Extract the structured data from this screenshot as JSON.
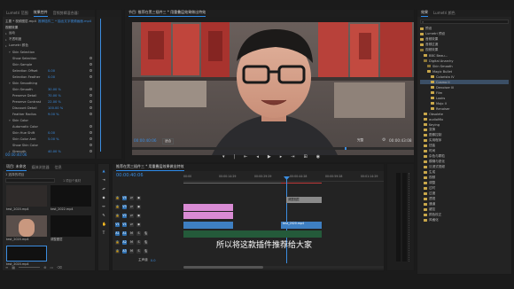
{
  "top_tabs": {
    "effect_controls": "Lumetri 范围",
    "project_tab": "效果控件",
    "audio_mixer": "音频剪辑混合器：",
    "source": "音频仪表"
  },
  "effect_controls": {
    "header": "主要 * 视频图层.mp4",
    "clip": "推荐插件二 * 抽出文字视频画面.mp4",
    "fx_title": "视频效果",
    "rows": [
      {
        "label": "运动",
        "value": ""
      },
      {
        "label": "不透明度",
        "value": ""
      },
      {
        "label": "Lumetri 颜色",
        "value": ""
      },
      {
        "label": "Skin Selection",
        "value": ""
      },
      {
        "label": "Show Selection",
        "value": ""
      },
      {
        "label": "Skin Sample",
        "value": ""
      },
      {
        "label": "Selection Offset",
        "value": "0.00"
      },
      {
        "label": "Selection Feather",
        "value": "0.00"
      },
      {
        "label": "Skin Smoothing",
        "value": ""
      },
      {
        "label": "Skin Smooth",
        "value": "30.00 %"
      },
      {
        "label": "Preserve Detail",
        "value": "70.00 %"
      },
      {
        "label": "Preserve Contrast",
        "value": "22.00 %"
      },
      {
        "label": "Discount Detail",
        "value": "100.00 %"
      },
      {
        "label": "Feather Radius",
        "value": "9.00 %"
      },
      {
        "label": "Skin Color",
        "value": ""
      },
      {
        "label": "Automatic Color",
        "value": ""
      },
      {
        "label": "Skin Hue Shift",
        "value": "0.00"
      },
      {
        "label": "Skin Color Amt",
        "value": "5.00 %"
      },
      {
        "label": "Show Skin Color",
        "value": ""
      },
      {
        "label": "Strength",
        "value": "40.00 %"
      }
    ],
    "timecode": "00:00:40:06"
  },
  "program_monitor": {
    "title": "节目: 推荐在黑三插件三 * 用重叠层效果做出特效",
    "timecode_left": "00:00:40:06",
    "zoom": "适合",
    "quality": "完整",
    "timecode_right": "00:00:43:08"
  },
  "project_panel": {
    "tabs": [
      "项目: 未命名",
      "媒体浏览器",
      "信息",
      "效果"
    ],
    "title": "1 选择的项目",
    "search_placeholder": "",
    "items": [
      {
        "name": "test_2020.mp4",
        "meta": "3:20"
      },
      {
        "name": "test_2022.mp4",
        "meta": "0:16"
      },
      {
        "name": "调整图层",
        "meta": ""
      },
      {
        "name": "test_2020.mp4",
        "meta": "0:21"
      }
    ],
    "bin_label": "1 项目个素材"
  },
  "timeline": {
    "title": "推荐在黑三插件三 * 用重叠层效果做出特效",
    "timecode": "00:00:40:06",
    "ruler": [
      "00:00",
      "00:00:14:29",
      "00:00:29:29",
      "00:00:44:28",
      "00:00:59:28",
      "00:01:14:29"
    ],
    "tracks_video": [
      "V4",
      "V3",
      "V2",
      "V1"
    ],
    "tracks_audio": [
      "A1",
      "A2",
      "A3"
    ],
    "master": "主声道",
    "clip_label_1": "调整图层",
    "clip_label_2": "test_2020.mp4",
    "subtitle": "所以将这款插件推荐给大家"
  },
  "effects_panel": {
    "tabs": [
      "效果",
      "Lumetri 颜色"
    ],
    "tree": [
      {
        "label": "预设",
        "open": false
      },
      {
        "label": "Lumetri 预设",
        "open": false
      },
      {
        "label": "音频效果",
        "open": false
      },
      {
        "label": "音频过渡",
        "open": false
      },
      {
        "label": "视频效果",
        "open": true
      },
      {
        "label": "BBC Beau...",
        "open": false
      },
      {
        "label": "Digital Anarchy",
        "open": true
      },
      {
        "label": "Skin Smooth",
        "open": true
      },
      {
        "label": "Magic Bullet",
        "open": false
      },
      {
        "label": "Colorista IV",
        "open": false
      },
      {
        "label": "Cosmo II",
        "open": false,
        "selected": true
      },
      {
        "label": "Denoiser III",
        "open": false
      },
      {
        "label": "Film",
        "open": false
      },
      {
        "label": "Looks",
        "open": false
      },
      {
        "label": "Mojo II",
        "open": false
      },
      {
        "label": "Renoiser",
        "open": false
      },
      {
        "label": "Obsolete",
        "open": false
      },
      {
        "label": "audioMix",
        "open": false
      },
      {
        "label": "Keying",
        "open": false
      },
      {
        "label": "变换",
        "open": false
      },
      {
        "label": "图像控制",
        "open": false
      },
      {
        "label": "实用程序",
        "open": false
      },
      {
        "label": "扭曲",
        "open": false
      },
      {
        "label": "时间",
        "open": false
      },
      {
        "label": "杂色与颗粒",
        "open": false
      },
      {
        "label": "模糊与锐化",
        "open": false
      },
      {
        "label": "沉浸式视频",
        "open": false
      },
      {
        "label": "生成",
        "open": false
      },
      {
        "label": "视频",
        "open": false
      },
      {
        "label": "调整",
        "open": false
      },
      {
        "label": "过时",
        "open": false
      },
      {
        "label": "过渡",
        "open": false
      },
      {
        "label": "透视",
        "open": false
      },
      {
        "label": "通道",
        "open": false
      },
      {
        "label": "键控",
        "open": false
      },
      {
        "label": "颜色校正",
        "open": false
      },
      {
        "label": "风格化",
        "open": false
      }
    ]
  },
  "colors": {
    "accent": "#2d8ceb",
    "clip_pink": "#d98bd4",
    "clip_blue": "#3e7fc2",
    "clip_gray": "#8a8a8a",
    "playhead": "#3b8de0"
  }
}
